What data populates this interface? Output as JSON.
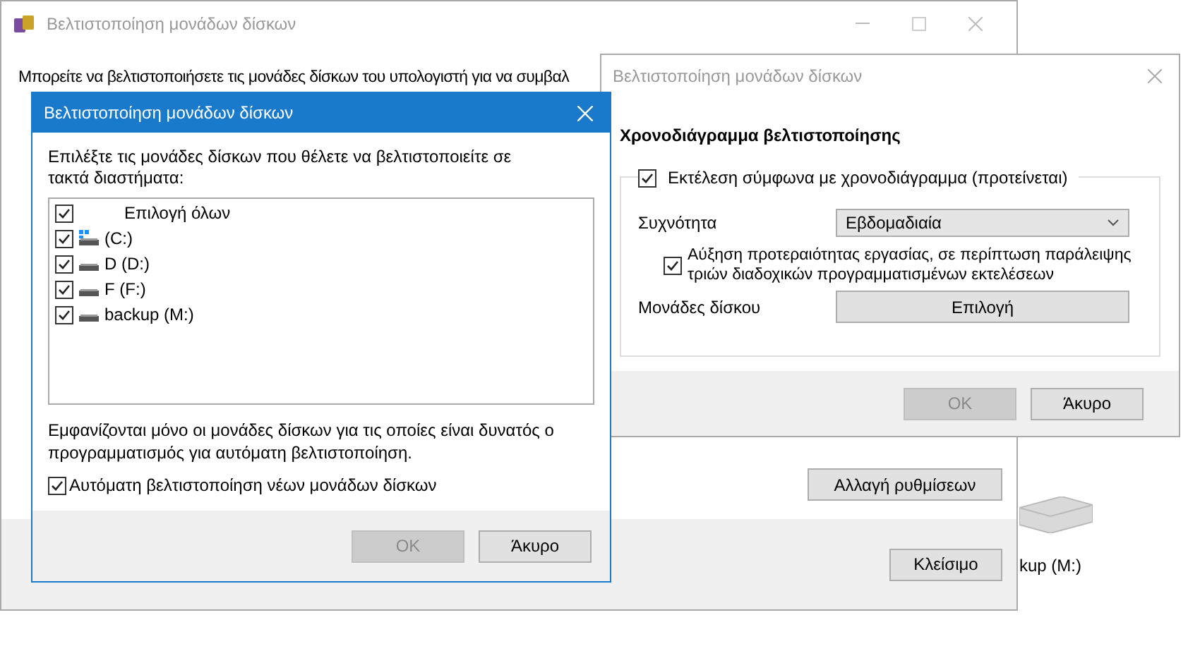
{
  "main_window": {
    "title": "Βελτιστοποίηση μονάδων δίσκων",
    "intro": "Μπορείτε να βελτιστοποιήσετε τις μονάδες δίσκων του υπολογιστή για να συμβαλ",
    "change_settings_button": "Αλλαγή ρυθμίσεων",
    "close_button": "Κλείσιμο"
  },
  "desktop_drive": {
    "label": "kup (M:)"
  },
  "schedule_dialog": {
    "title": "Βελτιστοποίηση μονάδων δίσκων",
    "active": false,
    "heading": "Χρονοδιάγραμμα βελτιστοποίησης",
    "run_on_schedule": {
      "label": "Εκτέλεση σύμφωνα με χρονοδιάγραμμα (προτείνεται)",
      "checked": true
    },
    "frequency_label": "Συχνότητα",
    "frequency": {
      "value": "Εβδομαδιαία"
    },
    "increase_priority": {
      "label": "Αύξηση προτεραιότητας εργασίας, σε περίπτωση παράλειψης τριών διαδοχικών προγραμματισμένων εκτελέσεων",
      "checked": true
    },
    "drives_label": "Μονάδες δίσκου",
    "choose_button": "Επιλογή",
    "ok_button": {
      "label": "OK",
      "disabled": true
    },
    "cancel_button": "Άκυρο"
  },
  "drives_dialog": {
    "title": "Βελτιστοποίηση μονάδων δίσκων",
    "active": true,
    "prompt": "Επιλέξτε τις μονάδες δίσκων που θέλετε να βελτιστοποιείτε σε τακτά διαστήματα:",
    "drives": [
      {
        "kind": "select_all",
        "label": "Επιλογή όλων",
        "checked": true
      },
      {
        "kind": "system",
        "label": "(C:)",
        "checked": true
      },
      {
        "kind": "drive",
        "label": "D (D:)",
        "checked": true
      },
      {
        "kind": "drive",
        "label": "F (F:)",
        "checked": true
      },
      {
        "kind": "drive",
        "label": "backup (M:)",
        "checked": true
      }
    ],
    "note": "Εμφανίζονται μόνο οι μονάδες δίσκων για τις οποίες είναι δυνατός ο προγραμματισμός για αυτόματη βελτιστοποίηση.",
    "auto_new": {
      "label": "Αυτόματη βελτιστοποίηση νέων μονάδων δίσκων",
      "checked": true
    },
    "ok_button": {
      "label": "OK",
      "disabled": true
    },
    "cancel_button": "Άκυρο"
  }
}
